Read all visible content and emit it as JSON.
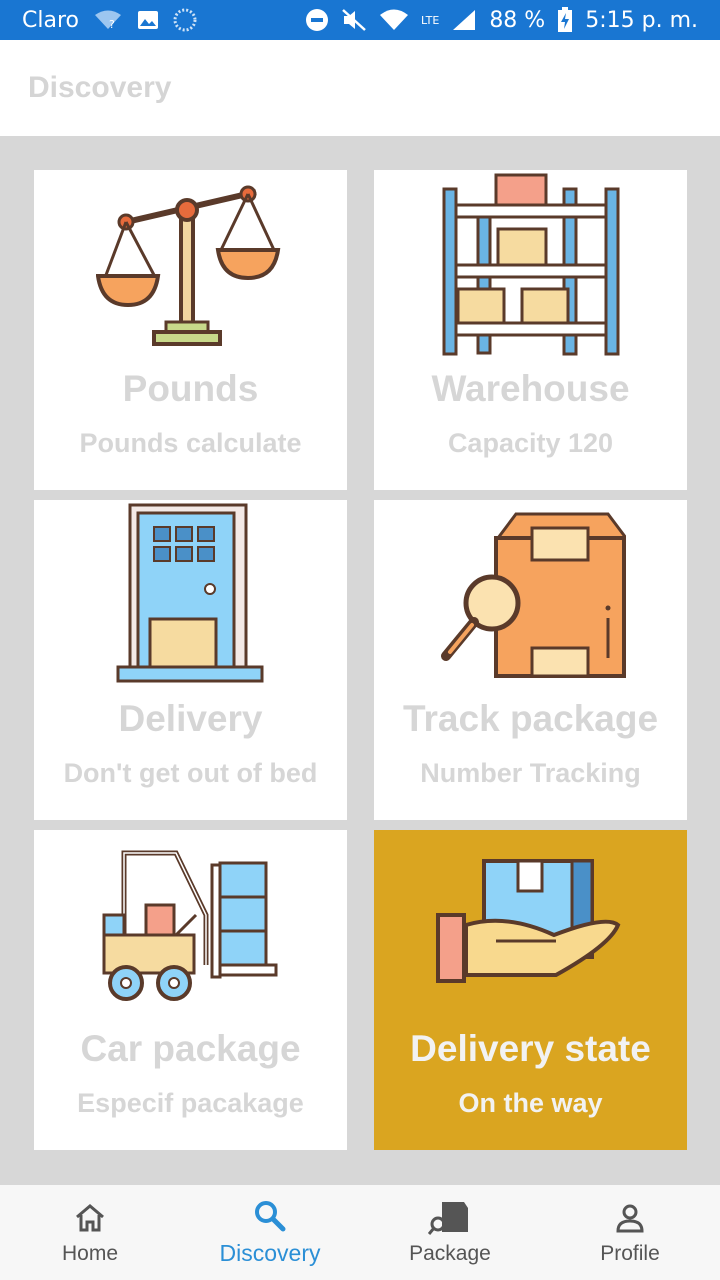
{
  "status_bar": {
    "carrier": "Claro",
    "battery": "88 %",
    "network": "LTE",
    "time": "5:15 p. m."
  },
  "app_bar": {
    "title": "Discovery"
  },
  "cards": [
    {
      "title": "Pounds",
      "subtitle": "Pounds calculate",
      "icon": "scale-icon"
    },
    {
      "title": "Warehouse",
      "subtitle": "Capacity 120",
      "icon": "warehouse-shelf-icon"
    },
    {
      "title": "Delivery",
      "subtitle": "Don't get out of bed",
      "icon": "door-delivery-icon"
    },
    {
      "title": "Track package",
      "subtitle": "Number Tracking",
      "icon": "track-box-icon"
    },
    {
      "title": "Car package",
      "subtitle": "Especif pacakage",
      "icon": "forklift-icon"
    },
    {
      "title": "Delivery state",
      "subtitle": "On the way",
      "icon": "hand-box-icon",
      "active": true
    }
  ],
  "bottom_nav": {
    "items": [
      {
        "label": "Home",
        "icon": "home-icon"
      },
      {
        "label": "Discovery",
        "icon": "search-icon",
        "active": true
      },
      {
        "label": "Package",
        "icon": "package-icon"
      },
      {
        "label": "Profile",
        "icon": "person-icon"
      }
    ]
  },
  "colors": {
    "status_bar": "#1976d2",
    "active_card": "#daa520",
    "active_nav": "#2b8fd6",
    "background": "#d7d7d7"
  }
}
